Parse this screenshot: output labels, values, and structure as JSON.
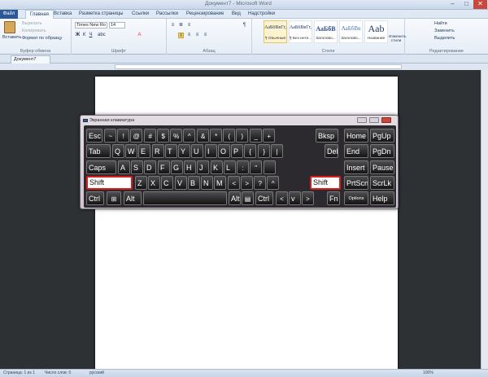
{
  "window": {
    "title": "Документ7 - Microsoft Word"
  },
  "tabs": [
    "Файл",
    "Главная",
    "Вставка",
    "Разметка страницы",
    "Ссылки",
    "Рассылки",
    "Рецензирование",
    "Вид",
    "Надстройки"
  ],
  "ribbon": {
    "clipboard": {
      "paste": "Вставить",
      "cut": "Вырезать",
      "copy": "Копировать",
      "format_painter": "Формат по образцу",
      "label": "Буфер обмена"
    },
    "font": {
      "family": "Times New Ro",
      "size": "14",
      "label": "Шрифт"
    },
    "paragraph": {
      "label": "Абзац"
    },
    "styles": {
      "label": "Стили",
      "items": [
        {
          "sample": "АаБбВвГг,",
          "name": "¶ Обычный"
        },
        {
          "sample": "АаБбВвГг,",
          "name": "¶ Без инте..."
        },
        {
          "sample": "АаБбВ",
          "name": "Заголово..."
        },
        {
          "sample": "АаБбВв",
          "name": "Заголово..."
        },
        {
          "sample": "Aab",
          "name": "Название"
        }
      ],
      "change": "Изменить стили"
    },
    "editing": {
      "find": "Найти",
      "replace": "Заменить",
      "select": "Выделить",
      "label": "Редактирование"
    }
  },
  "doc_tab": "Документ7",
  "osk": {
    "title": "Экранная клавиатура",
    "rows": [
      [
        "Esc",
        "~",
        "!",
        "@",
        "#",
        "$",
        "%",
        "^",
        "&",
        "*",
        "(",
        ")",
        "_",
        "+",
        "Bksp",
        "Home",
        "PgUp"
      ],
      [
        "Tab",
        "Q",
        "W",
        "E",
        "R",
        "T",
        "Y",
        "U",
        "I",
        "O",
        "P",
        "{",
        "}",
        "|",
        "Del",
        "End",
        "PgDn"
      ],
      [
        "Caps",
        "A",
        "S",
        "D",
        "F",
        "G",
        "H",
        "J",
        "K",
        "L",
        ":",
        "\"",
        "",
        "Insert",
        "Pause"
      ],
      [
        "Shift",
        "Z",
        "X",
        "C",
        "V",
        "B",
        "N",
        "M",
        "<",
        ">",
        "?",
        "^",
        "Shift",
        "PrtScn",
        "ScrLk"
      ],
      [
        "Ctrl",
        "⊞",
        "Alt",
        "",
        "Alt",
        "▤",
        "Ctrl",
        "<",
        "v",
        ">",
        "Fn",
        "Options",
        "Help"
      ]
    ]
  },
  "status": {
    "page": "Страница: 1 из 1",
    "words": "Число слов: 0",
    "lang": "русский",
    "zoom": "100%"
  }
}
